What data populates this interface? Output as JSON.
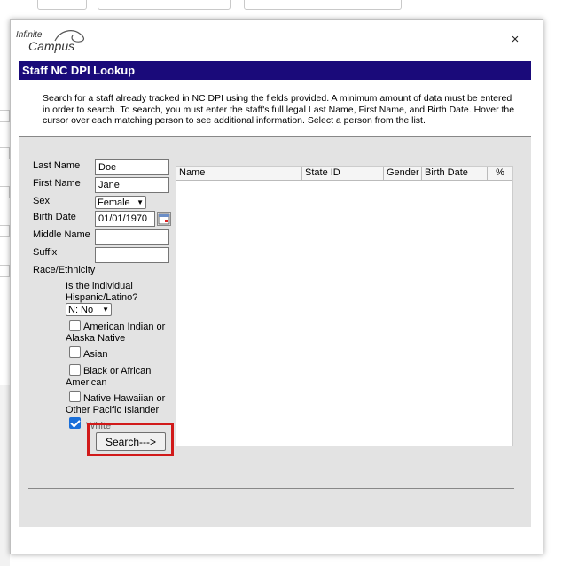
{
  "dialog": {
    "logo_top": "Infinite",
    "logo_bottom": "Campus",
    "close_label": "×",
    "title": "Staff NC DPI Lookup",
    "instructions": "Search for a staff already tracked in NC DPI using the fields provided. A minimum amount of data must be entered in order to search. To search, you must enter the staff's full legal Last Name, First Name, and Birth Date. Hover the cursor over each matching person to see additional information. Select a person from the list."
  },
  "form": {
    "last_name_label": "Last Name",
    "last_name_value": "Doe",
    "first_name_label": "First Name",
    "first_name_value": "Jane",
    "sex_label": "Sex",
    "sex_value": "Female",
    "birth_date_label": "Birth Date",
    "birth_date_value": "01/01/1970",
    "middle_name_label": "Middle Name",
    "middle_name_value": "",
    "suffix_label": "Suffix",
    "suffix_value": "",
    "race_label": "Race/Ethnicity",
    "hispanic_question": "Is the individual Hispanic/Latino?",
    "hispanic_value": "N: No",
    "races": [
      {
        "label": "American Indian or Alaska Native",
        "checked": false
      },
      {
        "label": "Asian",
        "checked": false
      },
      {
        "label": "Black or African American",
        "checked": false
      },
      {
        "label": "Native Hawaiian or Other Pacific Islander",
        "checked": false
      },
      {
        "label": "White",
        "checked": true
      }
    ],
    "search_button": "Search--->"
  },
  "results": {
    "columns": [
      "Name",
      "State ID",
      "Gender",
      "Birth Date",
      "%"
    ]
  },
  "colors": {
    "titlebar": "#1a0a7a",
    "highlight": "#d11a1a",
    "checkbox_checked": "#1a6fd9"
  }
}
